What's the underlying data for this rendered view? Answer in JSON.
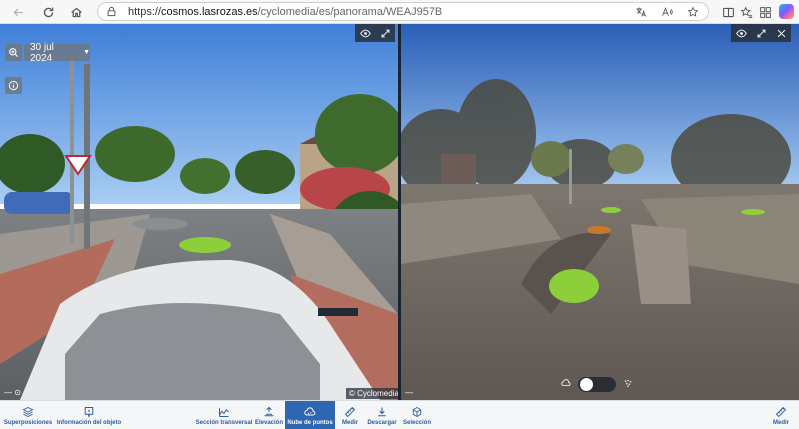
{
  "browser": {
    "url_prefix": "https://",
    "url_host": "cosmos.lasrozas.es",
    "url_path": "/cyclomedia/es/panorama/WEAJ957B"
  },
  "left_panel": {
    "date": "30 jul 2024",
    "bottom_left": "— ⊙",
    "credit": "© Cyclomedia"
  },
  "right_panel": {
    "bottom_left": "—"
  },
  "toolbar": {
    "overlays": "Superposiciones",
    "object_info": "Información del objeto",
    "cross_section": "Sección transversal",
    "elevation": "Elevación",
    "point_cloud": "Nube de puntos",
    "measure": "Medir",
    "download": "Descargar",
    "selection": "Selección",
    "measure_right": "Medir"
  },
  "colors": {
    "toolbar_accent": "#2c5ea0",
    "active_tool": "#2f66b3",
    "marker_green": "#8ccf3a"
  }
}
